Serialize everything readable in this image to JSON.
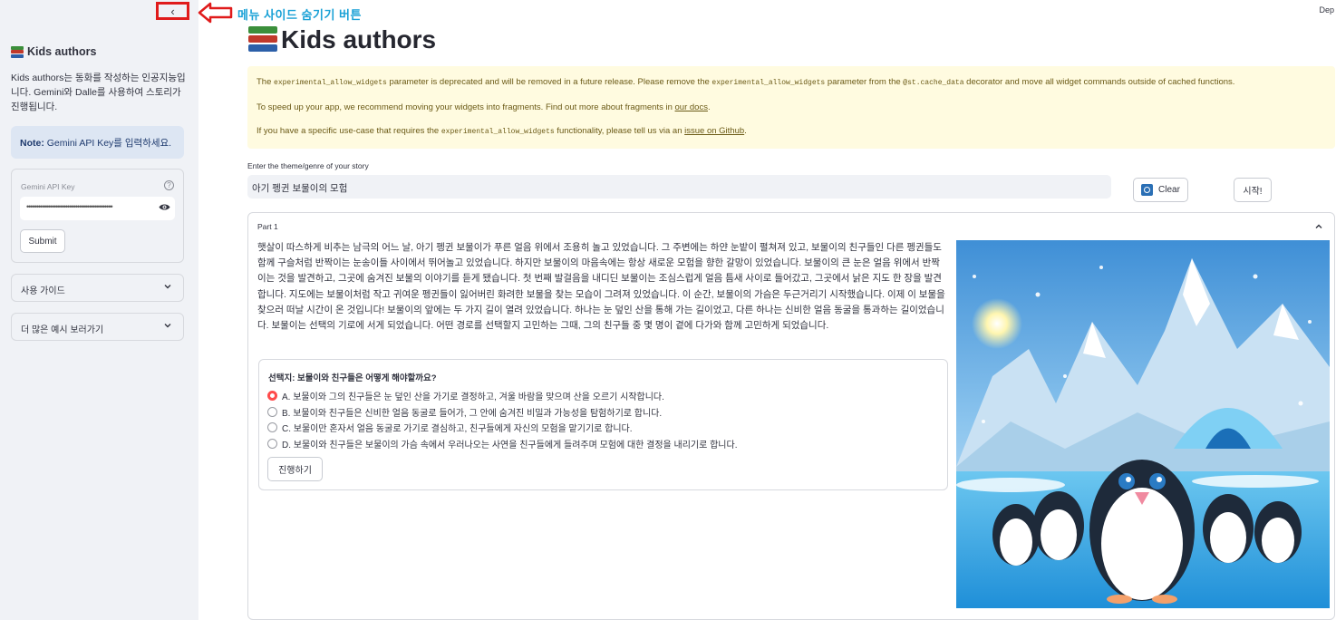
{
  "sidebar": {
    "collapse_glyph": "‹",
    "title": "Kids authors",
    "description": "Kids authors는 동화를 작성하는 인공지능입니다. Gemini와 Dalle를 사용하여 스토리가 진행됩니다.",
    "note_strong": "Note:",
    "note_text": " Gemini API Key를 입력하세요.",
    "api_key_label": "Gemini API Key",
    "api_key_value": "••••••••••••••••••••••••••••••••••••••••••••",
    "submit_label": "Submit",
    "expanders": [
      {
        "label": "사용 가이드"
      },
      {
        "label": "더 많은 예시 보러가기"
      }
    ]
  },
  "annotation": {
    "text": "메뉴 사이드 숨기기 버튼",
    "color": "#1aa1d6",
    "highlight_color": "#e01b1b"
  },
  "header": {
    "deploy_text": "Dep"
  },
  "main": {
    "title": "Kids authors",
    "warning": {
      "line1_a": "The ",
      "line1_code1": "experimental_allow_widgets",
      "line1_b": " parameter is deprecated and will be removed in a future release. Please remove the ",
      "line1_code2": "experimental_allow_widgets",
      "line1_c": " parameter from the ",
      "line1_code3": "@st.cache_data",
      "line1_d": " decorator and move all widget commands outside of cached functions.",
      "line2_a": "To speed up your app, we recommend moving your widgets into fragments. Find out more about fragments in ",
      "line2_link": "our docs",
      "line2_b": ".",
      "line3_a": "If you have a specific use-case that requires the ",
      "line3_code": "experimental_allow_widgets",
      "line3_b": " functionality, please tell us via an ",
      "line3_link": "issue on Github",
      "line3_c": "."
    },
    "theme_label": "Enter the theme/genre of your story",
    "theme_value": "아기 펭귄 보물이의 모험",
    "clear_label": "Clear",
    "start_label": "시작!",
    "part": {
      "label": "Part 1",
      "story": "햇살이 따스하게 비추는 남극의 어느 날, 아기 펭귄 보물이가 푸른 얼음 위에서 조용히 놀고 있었습니다. 그 주변에는 하얀 눈밭이 펼쳐져 있고, 보물이의 친구들인 다른 펭귄들도 함께 구슬처럼 반짝이는 눈송이들 사이에서 뛰어놀고 있었습니다. 하지만 보물이의 마음속에는 항상 새로운 모험을 향한 갈망이 있었습니다. 보물이의 큰 눈은 얼음 위에서 반짝이는 것을 발견하고, 그곳에 숨겨진 보물의 이야기를 듣게 됐습니다. 첫 번째 발걸음을 내디딘 보물이는 조심스럽게 얼음 틈새 사이로 들어갔고, 그곳에서 낡은 지도 한 장을 발견합니다. 지도에는 보물이처럼 작고 귀여운 펭귄들이 잃어버린 화려한 보물을 찾는 모습이 그려져 있었습니다. 이 순간, 보물이의 가슴은 두근거리기 시작했습니다. 이제 이 보물을 찾으러 떠날 시간이 온 것입니다! 보물이의 앞에는 두 가지 길이 열려 있었습니다. 하나는 눈 덮인 산을 통해 가는 길이었고, 다른 하나는 신비한 얼음 동굴을 통과하는 길이었습니다. 보물이는 선택의 기로에 서게 되었습니다. 어떤 경로를 선택할지 고민하는 그때, 그의 친구들 중 몇 명이 곁에 다가와 함께 고민하게 되었습니다.",
      "question": "선택지: 보물이와 친구들은 어떻게 해야할까요?",
      "options": [
        {
          "label": "A. 보물이와 그의 친구들은 눈 덮인 산을 가기로 결정하고, 겨울 바람을 맞으며 산을 오르기 시작합니다."
        },
        {
          "label": "B. 보물이와 친구들은 신비한 얼음 동굴로 들어가, 그 안에 숨겨진 비밀과 가능성을 탐험하기로 합니다."
        },
        {
          "label": "C. 보물이만 혼자서 얼음 동굴로 가기로 결심하고, 친구들에게 자신의 모험을 맡기기로 합니다."
        },
        {
          "label": "D. 보물이와 친구들은 보물이의 가슴 속에서 우러나오는 사연을 친구들에게 들려주며 모험에 대한 결정을 내리기로 합니다."
        }
      ],
      "selected_index": 0,
      "proceed_label": "진행하기"
    }
  },
  "colors": {
    "sidebar_bg": "#f0f2f6",
    "warning_bg": "#fffbe0",
    "note_bg": "#dde6f3",
    "radio_accent": "#ff4b4b"
  }
}
